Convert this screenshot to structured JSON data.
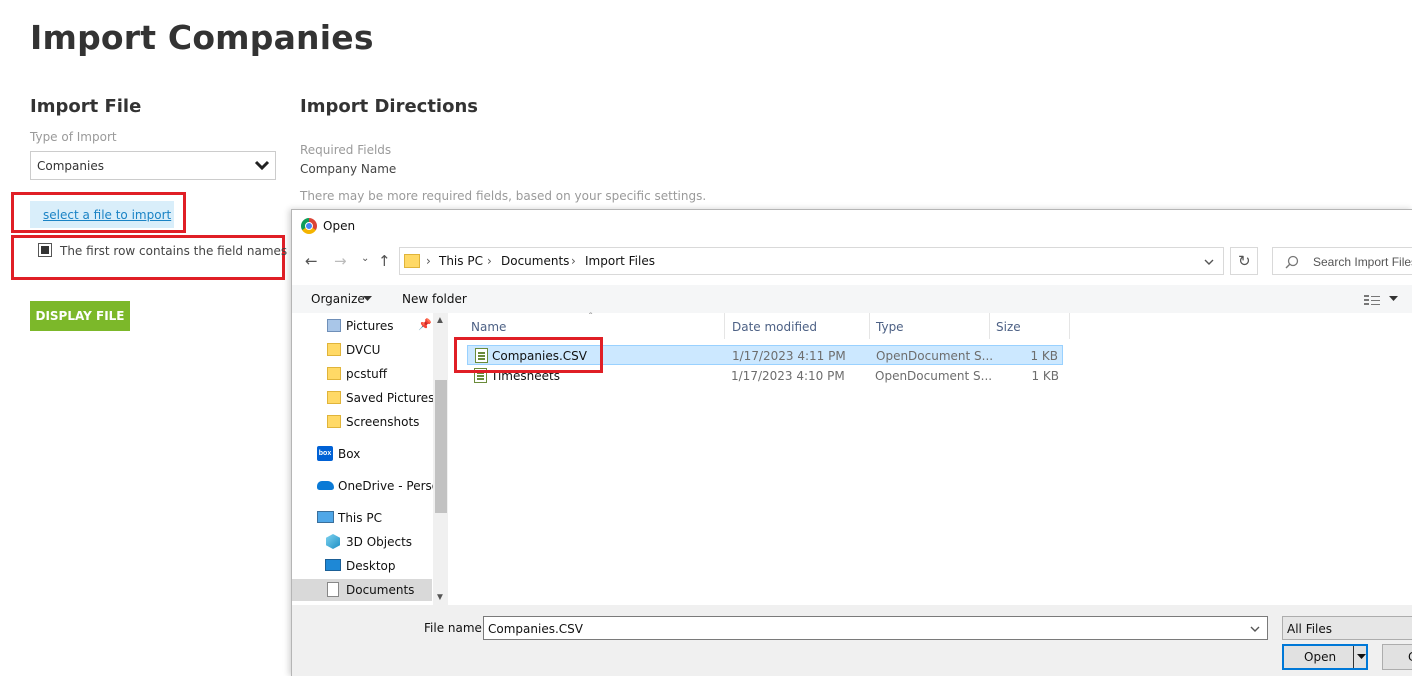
{
  "page": {
    "title": "Import Companies",
    "import_file": {
      "heading": "Import File",
      "type_label": "Type of Import",
      "type_value": "Companies",
      "select_file_link": "select a file to import",
      "first_row_label": "The first row contains the field names",
      "first_row_checked": true,
      "display_button": "DISPLAY FILE"
    },
    "directions": {
      "heading": "Import Directions",
      "required_label": "Required Fields",
      "required_value": "Company Name",
      "note": "There may be more required fields, based on your specific settings."
    }
  },
  "dialog": {
    "title": "Open",
    "breadcrumb": [
      "This PC",
      "Documents",
      "Import Files"
    ],
    "search_placeholder": "Search Import Files",
    "toolbar": {
      "organize": "Organize",
      "new_folder": "New folder"
    },
    "nav_items": [
      {
        "label": "Pictures",
        "icon": "pictures-folder-icon",
        "pinned": true
      },
      {
        "label": "DVCU",
        "icon": "folder-icon"
      },
      {
        "label": "pcstuff",
        "icon": "folder-icon"
      },
      {
        "label": "Saved Pictures",
        "icon": "folder-icon"
      },
      {
        "label": "Screenshots",
        "icon": "folder-icon"
      },
      {
        "label": "Box",
        "icon": "box-icon"
      },
      {
        "label": "OneDrive - Persor",
        "icon": "onedrive-icon"
      },
      {
        "label": "This PC",
        "icon": "pc-icon"
      },
      {
        "label": "3D Objects",
        "icon": "3d-objects-icon"
      },
      {
        "label": "Desktop",
        "icon": "desktop-icon"
      },
      {
        "label": "Documents",
        "icon": "documents-icon",
        "selected": true
      }
    ],
    "columns": [
      "Name",
      "Date modified",
      "Type",
      "Size"
    ],
    "files": [
      {
        "name": "Companies.CSV",
        "date": "1/17/2023 4:11 PM",
        "type": "OpenDocument S...",
        "size": "1 KB",
        "selected": true
      },
      {
        "name": "Timesheets",
        "date": "1/17/2023 4:10 PM",
        "type": "OpenDocument S...",
        "size": "1 KB",
        "selected": false
      }
    ],
    "file_name_label": "File name:",
    "file_name_value": "Companies.CSV",
    "file_type": "All Files",
    "open_button": "Open",
    "cancel_button": "C"
  },
  "colors": {
    "highlight": "#e01f26",
    "primary_green": "#7cb82a",
    "link_blue": "#1a83c5",
    "selection": "#cce8ff"
  }
}
